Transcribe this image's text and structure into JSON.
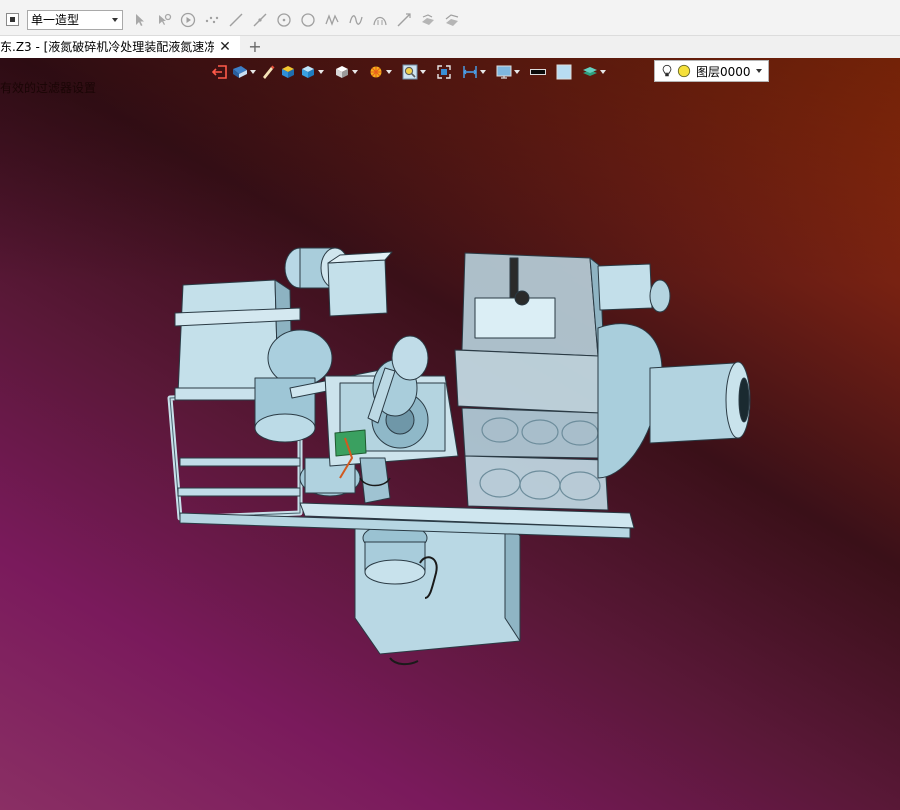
{
  "toolbar": {
    "filter_value": "单一造型",
    "icons": [
      "pointer-icon",
      "filter-pointer-icon",
      "play-icon",
      "point-cloud-icon",
      "line-icon",
      "line-tangent-icon",
      "circle-center-icon",
      "circle-icon",
      "spline-icon",
      "polyline-icon",
      "arc-icon",
      "curve-icon",
      "surface-icon",
      "surface-offset-icon"
    ]
  },
  "tabs": {
    "active_title": "东.Z3 - [液氮破碎机冷处理装配液氮速冻]",
    "close_symbol": "✕",
    "add_symbol": "+"
  },
  "viewport": {
    "filter_message": "有效的过滤器设置"
  },
  "view_toolbar": {
    "layer_name": "图层0000"
  },
  "colors": {
    "bg_top_right": "#a63208",
    "bg_bottom_left": "#8a1a6a",
    "model_fill": "#b8dce8"
  }
}
